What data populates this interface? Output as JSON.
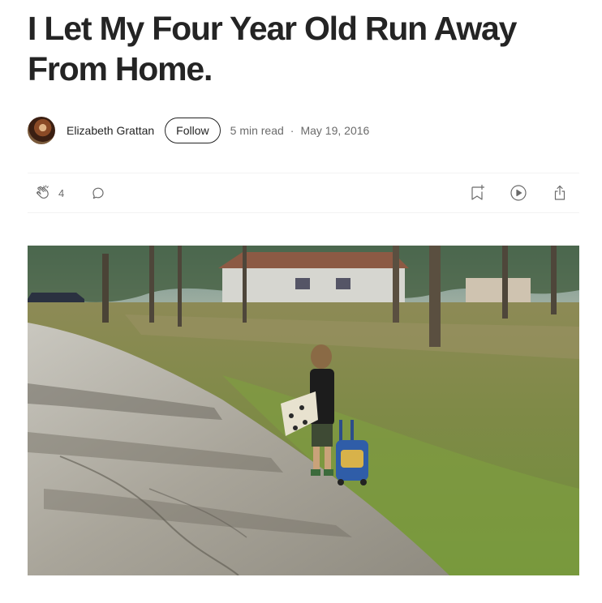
{
  "article": {
    "title": "I Let My Four Year Old Run Away From Home."
  },
  "byline": {
    "author": "Elizabeth Grattan",
    "follow_label": "Follow",
    "read_time": "5 min read",
    "separator": "·",
    "date": "May 19, 2016"
  },
  "actions": {
    "clap_count": "4",
    "icons": [
      "clap-icon",
      "comment-icon",
      "bookmark-add-icon",
      "play-icon",
      "share-icon"
    ],
    "icon_color": "#6b6b6b"
  },
  "colors": {
    "text": "#242424",
    "muted": "#6b6b6b",
    "divider": "#f2f2f2"
  }
}
